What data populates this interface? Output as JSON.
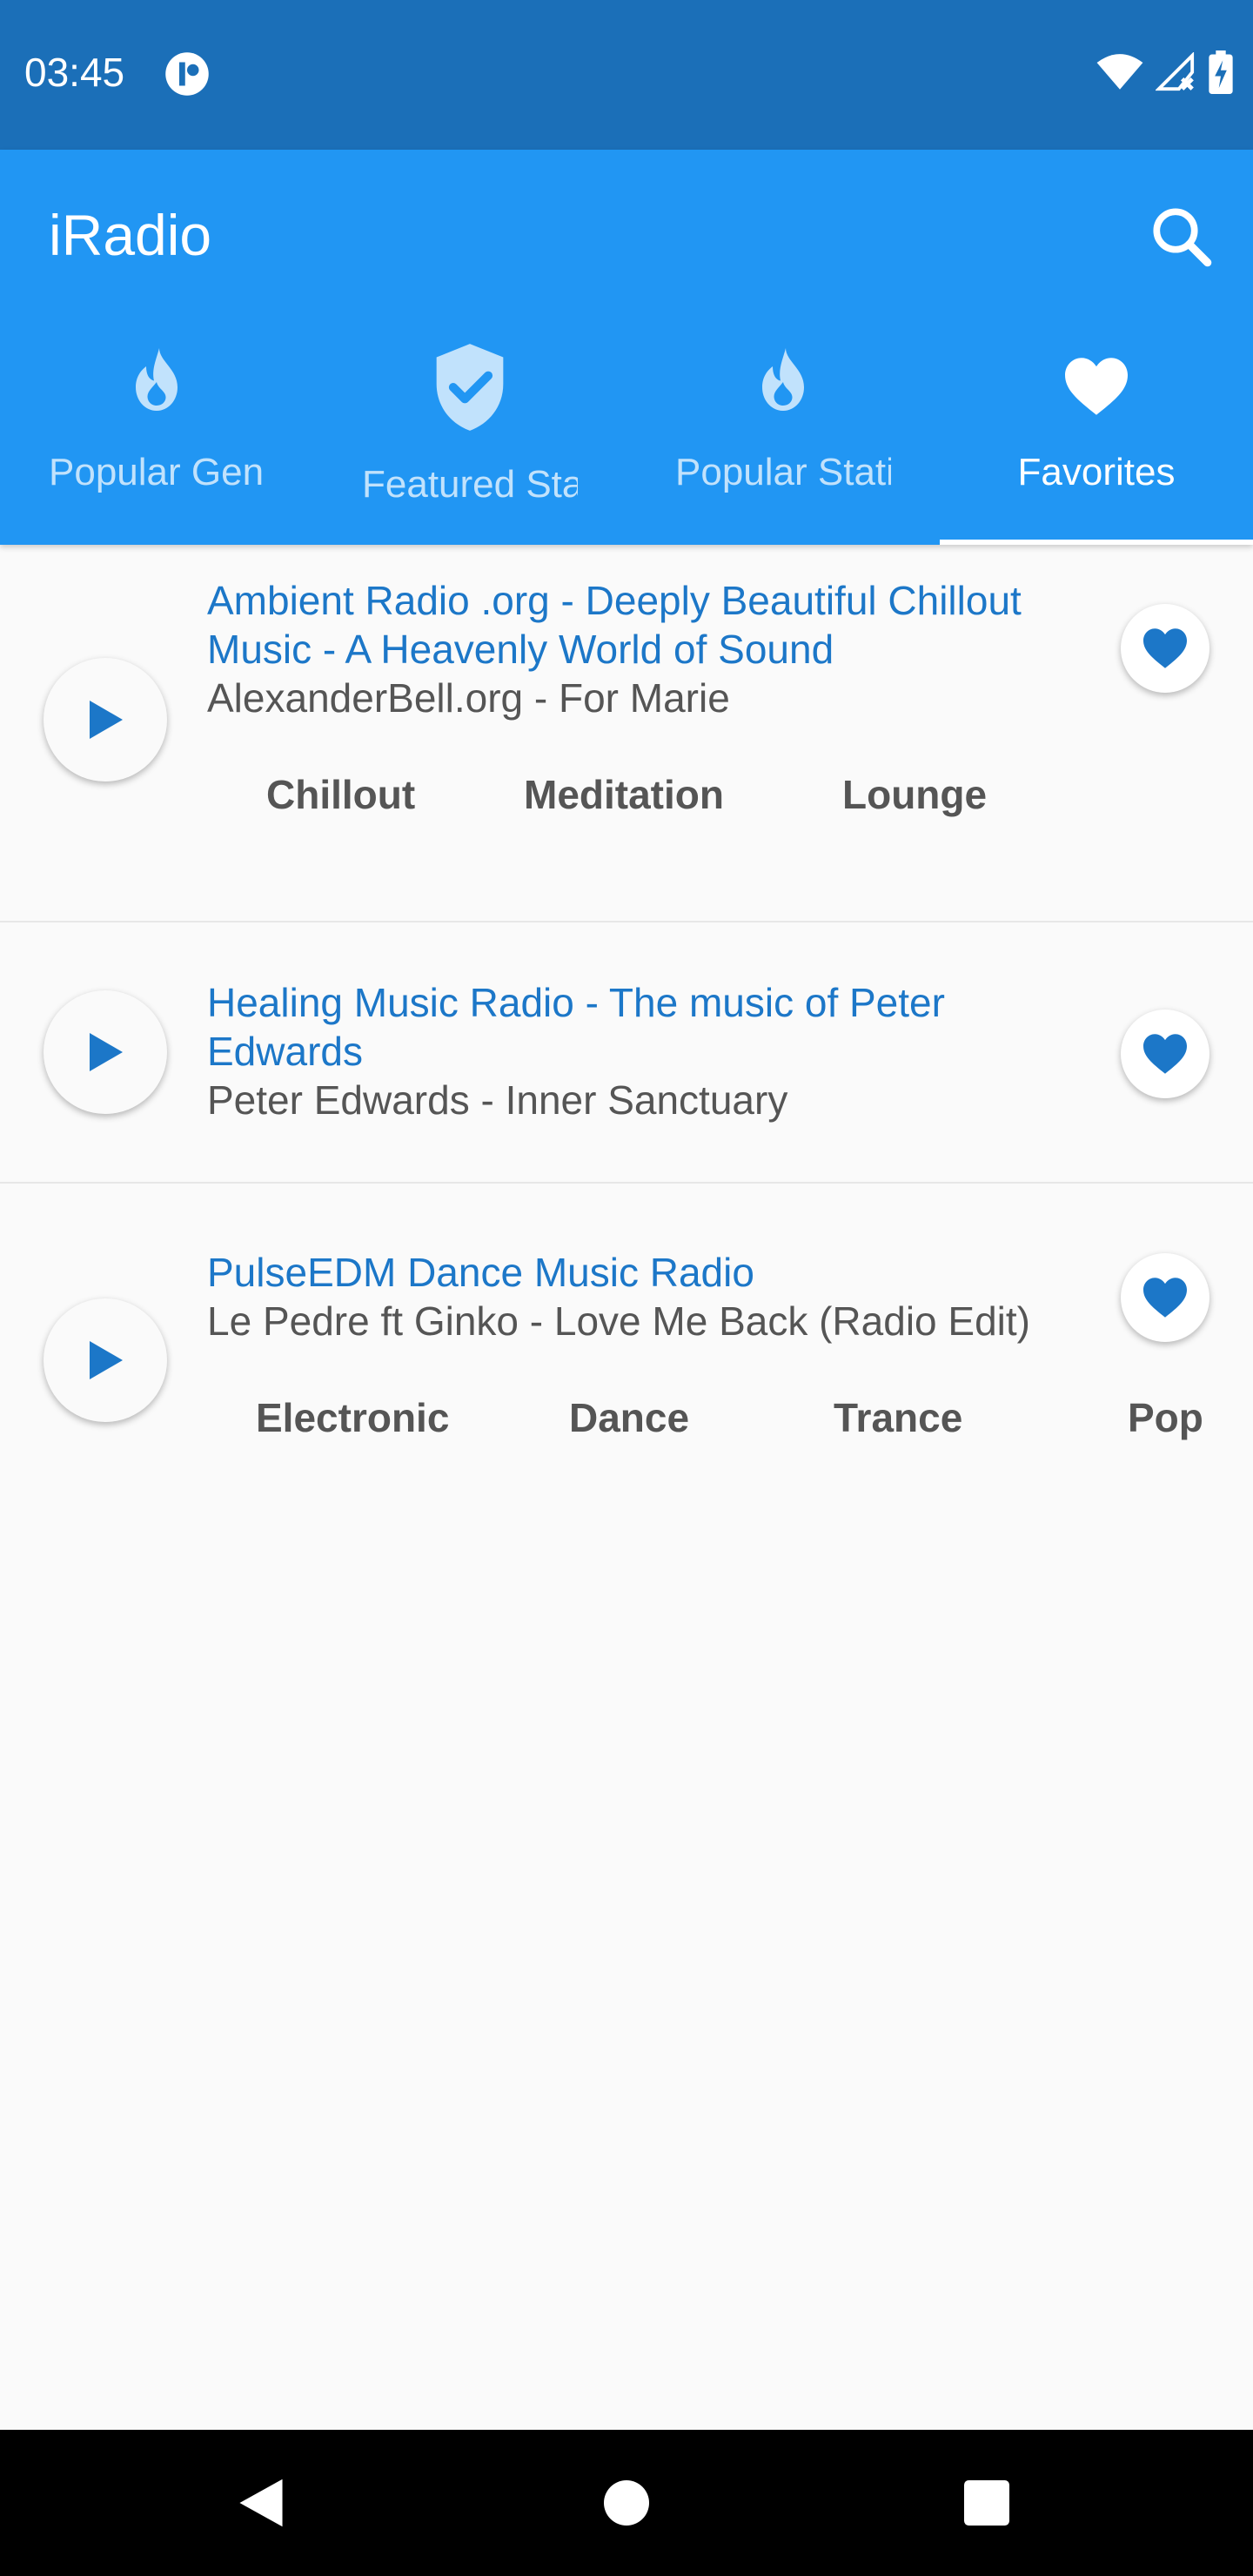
{
  "status_bar": {
    "time": "03:45",
    "icons": [
      "app-notification-icon",
      "wifi-icon",
      "signal-icon",
      "battery-charging-icon"
    ]
  },
  "app_bar": {
    "title": "iRadio",
    "search_icon": "search-icon"
  },
  "tabs": [
    {
      "label": "Popular Genres",
      "icon": "flame-icon",
      "active": false
    },
    {
      "label": "Featured Stations",
      "icon": "verified-shield-icon",
      "active": false
    },
    {
      "label": "Popular Stations",
      "icon": "flame-icon",
      "active": false
    },
    {
      "label": "Favorites",
      "icon": "heart-icon",
      "active": true
    }
  ],
  "favorites": [
    {
      "title": "Ambient Radio .org - Deeply Beautiful Chillout Music - A Heavenly World of Sound",
      "now_playing": "AlexanderBell.org - For Marie",
      "tags": [
        "Chillout",
        "Meditation",
        "Lounge"
      ],
      "favorited": true
    },
    {
      "title": "Healing Music Radio - The music of Peter Edwards",
      "now_playing": "Peter Edwards - Inner Sanctuary",
      "tags": [],
      "favorited": true
    },
    {
      "title": "PulseEDM Dance Music Radio",
      "now_playing": "Le Pedre ft Ginko - Love Me Back (Radio Edit)",
      "tags": [
        "Electronic",
        "Dance",
        "Trance",
        "Pop"
      ],
      "favorited": true
    }
  ],
  "nav_bar": {
    "icons": [
      "back-icon",
      "home-icon",
      "recents-icon"
    ]
  },
  "colors": {
    "status_bar": "#1b6fb8",
    "primary": "#2196f3",
    "accent": "#1c77c8",
    "background": "#fafafa"
  }
}
